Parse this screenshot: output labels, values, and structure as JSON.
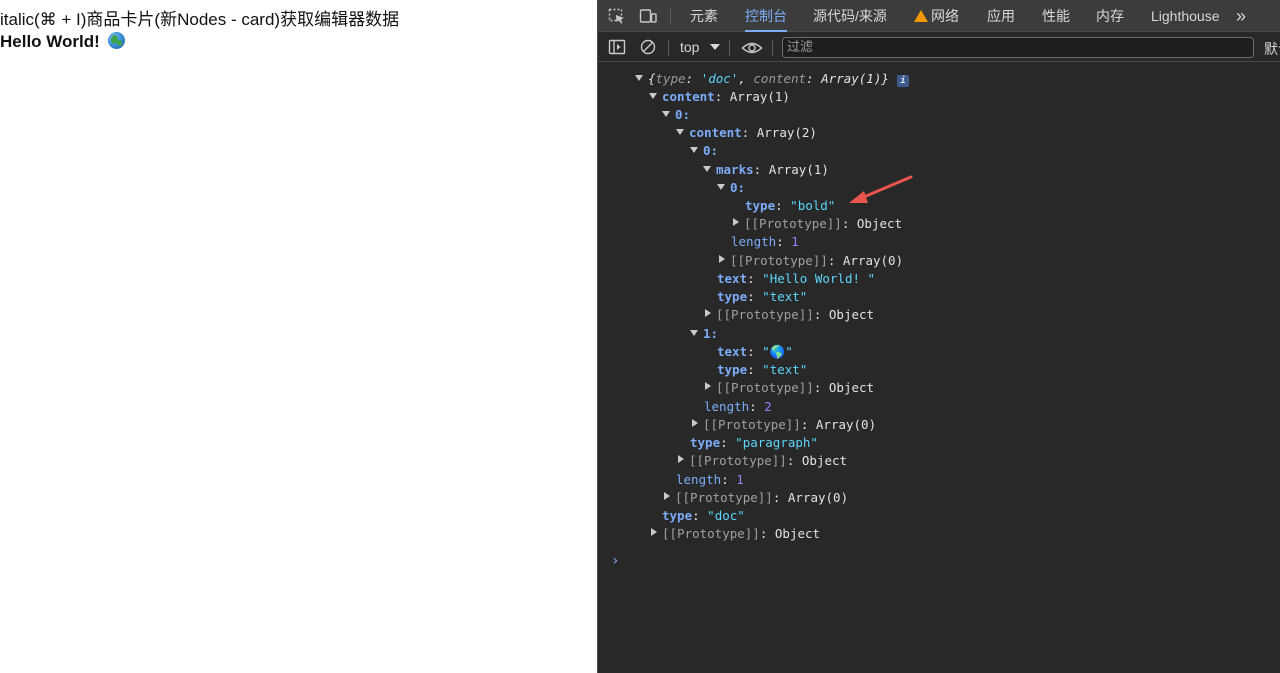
{
  "page": {
    "title": "italic(⌘ + I)商品卡片(新Nodes - card)获取编辑器数据",
    "content_text": "Hello World!",
    "content_emoji": "🌎"
  },
  "devtools": {
    "tabs": [
      {
        "label": "元素"
      },
      {
        "label": "控制台"
      },
      {
        "label": "源代码/来源"
      },
      {
        "label": "网络"
      },
      {
        "label": "应用"
      },
      {
        "label": "性能"
      },
      {
        "label": "内存"
      },
      {
        "label": "Lighthouse"
      }
    ],
    "more_tabs": "»",
    "toolbar": {
      "context": "top",
      "filter_placeholder": "过滤",
      "default_levels": "默认"
    },
    "console": {
      "summary": {
        "type_key": "type",
        "type_val": "'doc'",
        "content_key": "content",
        "content_val": "Array(1)"
      },
      "lines": {
        "l1_key": "content",
        "l1_val": "Array(1)",
        "l2_key": "0:",
        "l3_key": "content",
        "l3_val": "Array(2)",
        "l4_key": "0:",
        "l5_key": "marks",
        "l5_val": "Array(1)",
        "l6_key": "0:",
        "l7_key": "type",
        "l7_val": "\"bold\"",
        "l8_key": "[[Prototype]]",
        "l8_val": "Object",
        "l9_key": "length",
        "l9_val": "1",
        "l10_key": "[[Prototype]]",
        "l10_val": "Array(0)",
        "l11_key": "text",
        "l11_val": "\"Hello World! \"",
        "l12_key": "type",
        "l12_val": "\"text\"",
        "l13_key": "[[Prototype]]",
        "l13_val": "Object",
        "l14_key": "1:",
        "l15_key": "text",
        "l15_val": "\"🌎\"",
        "l16_key": "type",
        "l16_val": "\"text\"",
        "l17_key": "[[Prototype]]",
        "l17_val": "Object",
        "l18_key": "length",
        "l18_val": "2",
        "l19_key": "[[Prototype]]",
        "l19_val": "Array(0)",
        "l20_key": "type",
        "l20_val": "\"paragraph\"",
        "l21_key": "[[Prototype]]",
        "l21_val": "Object",
        "l22_key": "length",
        "l22_val": "1",
        "l23_key": "[[Prototype]]",
        "l23_val": "Array(0)",
        "l24_key": "type",
        "l24_val": "\"doc\"",
        "l25_key": "[[Prototype]]",
        "l25_val": "Object"
      },
      "prompt": "›"
    },
    "annotation_color": "#e8554e"
  }
}
